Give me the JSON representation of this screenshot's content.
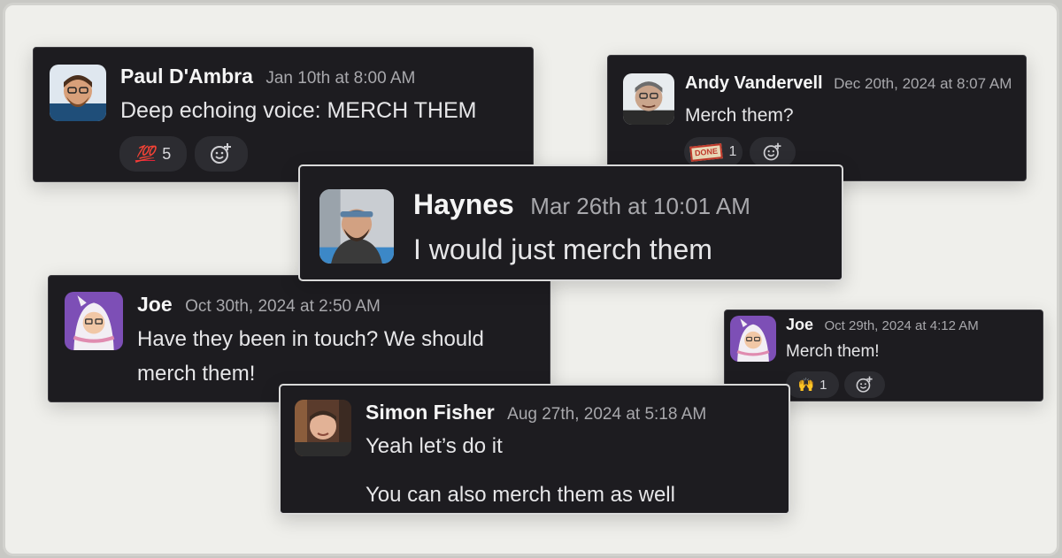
{
  "messages": {
    "paul": {
      "name": "Paul D'Ambra",
      "time": "Jan 10th at 8:00 AM",
      "text": "Deep echoing voice: MERCH THEM",
      "reaction_emoji": "100-emoji",
      "reaction_glyph": "💯",
      "reaction_count": "5"
    },
    "andy": {
      "name": "Andy Vandervell",
      "time": "Dec 20th, 2024 at 8:07 AM",
      "text": "Merch them?",
      "reaction_emoji": "done-emoji",
      "reaction_glyph": "DONE",
      "reaction_count": "1"
    },
    "haynes": {
      "name": "Haynes",
      "time": "Mar 26th at 10:01 AM",
      "text": "I would just merch them"
    },
    "joe1": {
      "name": "Joe",
      "time": "Oct 30th, 2024 at 2:50 AM",
      "text_line1": "Have they been in touch? We should",
      "text_line2": "merch them!"
    },
    "joe2": {
      "name": "Joe",
      "time": "Oct 29th, 2024 at 4:12 AM",
      "text": "Merch them!",
      "reaction_emoji": "raised-hands-emoji",
      "reaction_glyph": "🙌",
      "reaction_count": "1"
    },
    "simon": {
      "name": "Simon Fisher",
      "time": "Aug 27th, 2024 at 5:18 AM",
      "text_line1": "Yeah let’s do it",
      "text_line2": "You can also merch them as well"
    }
  },
  "colors": {
    "background": "#efefeb",
    "card": "#1d1c20",
    "pill": "#2c2c31",
    "name": "#f5f5f5",
    "timestamp": "#a8a8ac"
  }
}
